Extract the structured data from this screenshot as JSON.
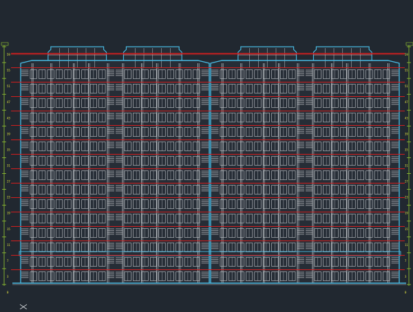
{
  "drawing": {
    "floors": 14,
    "units_per_building": 2,
    "buildings": 2,
    "level_marks": [
      "59",
      "55",
      "51",
      "47",
      "43",
      "39",
      "35",
      "31",
      "27",
      "23",
      "19",
      "15",
      "11",
      "7",
      "3",
      "0"
    ]
  },
  "colors": {
    "background": "#212830",
    "outline": "#48b8e0",
    "floor_line": "#d41e1e",
    "facade": "#c8ccd0",
    "balcony": "#8e9297",
    "dim": "#9acd32",
    "text": "#e8e840"
  },
  "icons": {
    "ucs": "ucs-cross-icon"
  }
}
